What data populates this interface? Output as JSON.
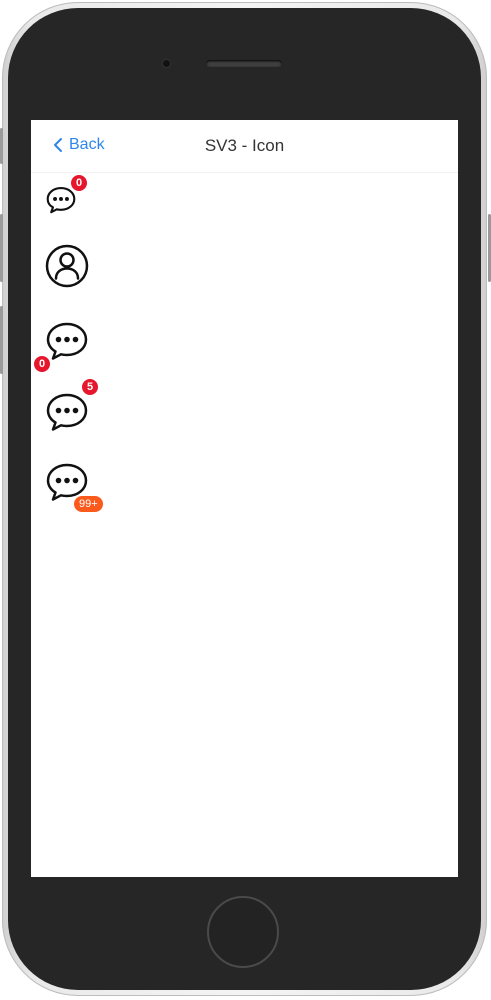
{
  "nav": {
    "back_label": "Back",
    "title": "SV3 - Icon"
  },
  "icons": [
    {
      "icon": "chat-bubble-icon",
      "badge": "0",
      "badge_color": "#e6162d"
    },
    {
      "icon": "user-circle-icon"
    },
    {
      "icon": "chat-bubble-icon",
      "badge": "0",
      "badge_color": "#e6162d"
    },
    {
      "icon": "chat-bubble-icon",
      "badge": "5",
      "badge_color": "#e6162d"
    },
    {
      "icon": "chat-bubble-icon",
      "badge": "99+",
      "badge_color": "#fb5a1d"
    }
  ],
  "colors": {
    "accent": "#2f86e8",
    "badge_red": "#e6162d",
    "badge_orange": "#fb5a1d"
  }
}
